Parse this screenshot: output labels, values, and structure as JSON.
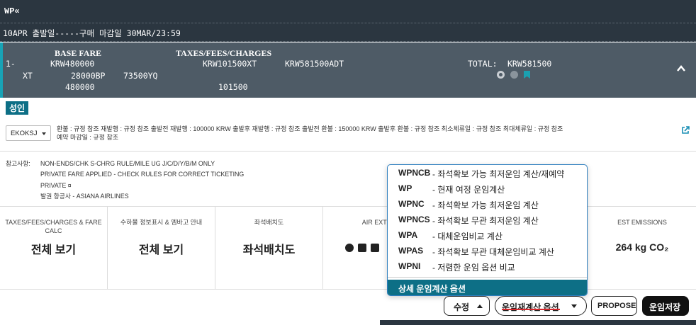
{
  "terminal": {
    "command": "WP«",
    "line2": "10APR 출발일-----구매 마감일 30MAR/23:59"
  },
  "fare": {
    "base_fare_header": "BASE FARE",
    "taxes_header": "TAXES/FEES/CHARGES",
    "row1_index": "1-",
    "row1_base": "KRW480000",
    "row1_tax": "KRW101500XT",
    "row1_total_adt": "KRW581500ADT",
    "row1_total_label": "TOTAL:",
    "row1_total_value": "KRW581500",
    "row2_xt": "XT",
    "row2_bp": "28000BP",
    "row2_yq": "73500YQ",
    "row3_base": "480000",
    "row3_tax": "101500"
  },
  "passenger_badge": "성인",
  "rules": {
    "select_value": "EKOKSJ",
    "line1": "환불 : 규정 참조   재발행 : 규정 참조   출발전 재발행 : 100000 KRW   출발후 재발행 : 규정 참조   출발전 환불 : 150000 KRW   출발후 환불 : 규정 참조   최소체류일 : 규정 참조   최대체류일 : 규정 참조",
    "line2": "예약 마감일 : 규정 참조"
  },
  "notes": {
    "label": "참고사항:",
    "lines": [
      "NON-ENDS/CHK S-CHRG RULE/MILE UG J/C/D/Y/B/M ONLY",
      "PRIVATE FARE APPLIED - CHECK RULES FOR CORRECT TICKETING",
      "PRIVATE ¤",
      "발권 항공사 - ASIANA AIRLINES"
    ]
  },
  "cards": [
    {
      "title": "TAXES/FEES/CHARGES & FARE CALC",
      "value": "전체 보기"
    },
    {
      "title": "수하물 정보표시 & 엠바고 안내",
      "value": "전체 보기"
    },
    {
      "title": "좌석배치도",
      "value": "좌석배치도"
    },
    {
      "title": "AIR EXTR",
      "value": ""
    },
    {
      "title": "EST EMISSIONS",
      "value": "264 kg CO₂"
    }
  ],
  "dropdown": {
    "items": [
      {
        "code": "WPNCB",
        "desc": "- 좌석확보 가능 최저운임 계산/재예약"
      },
      {
        "code": "WP",
        "desc": "- 현재 여정 운임계산"
      },
      {
        "code": "WPNC",
        "desc": "- 좌석확보 가능 최저운임 계산"
      },
      {
        "code": "WPNCS",
        "desc": "- 좌석확보 무관 최저운임 계산"
      },
      {
        "code": "WPA",
        "desc": "- 대체운임비교 계산"
      },
      {
        "code": "WPAS",
        "desc": "- 좌석확보 무관 대체운임비교 계산"
      },
      {
        "code": "WPNI",
        "desc": "- 저렴한 운임 옵션 비교"
      }
    ],
    "detail_option": "상세 운임계산 옵션"
  },
  "buttons": {
    "edit": "수정",
    "recalc": "운임재계산 옵션",
    "propose": "PROPOSE",
    "save": "운임저장"
  },
  "colors": {
    "terminal_bg": "#2b3640",
    "fare_bg": "#4e5b66",
    "accent": "#0d6f86",
    "underline": "#d8262a"
  }
}
